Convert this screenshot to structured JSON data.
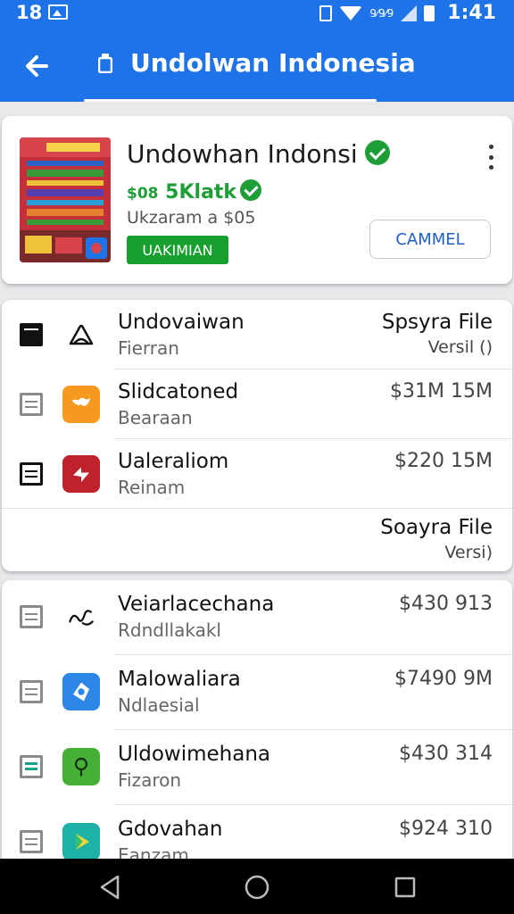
{
  "status_bar": {
    "left_text": "18",
    "signal_text": "9⁄9⁄9",
    "time": "1:41"
  },
  "app_bar": {
    "title": "Undolwan Indonesia",
    "icons": [
      "back-arrow-icon",
      "lock-icon"
    ]
  },
  "header": {
    "app_name": "Undowhan Indonsi",
    "price_prefix": "$08",
    "price_text": "5Klatk",
    "size_text": "Ukzaram a  $05",
    "badge": "UAKIMIAN",
    "cancel_label": "CAMMEL",
    "accent": "#1f73e8",
    "green": "#1e9e36"
  },
  "list1": {
    "rows": [
      {
        "name": "Undovaiwan",
        "sub": "Fierran",
        "amount": "Spsyra File",
        "amount2": "Versil ()",
        "icon": "recycle-outline-icon"
      },
      {
        "name": "Slidcatoned",
        "sub": "Bearaan",
        "amount": "$31M 15M",
        "amount2": "",
        "icon": "bird-icon"
      },
      {
        "name": "Ualeraliom",
        "sub": "Reinam",
        "amount": "$220  15M",
        "amount2": "",
        "icon": "arrow-right-icon"
      }
    ],
    "footer_title": "Soayra File",
    "footer_sub": "Versi)"
  },
  "list2": {
    "rows": [
      {
        "name": "Veiarlacechana",
        "sub": "Rdndllakakl",
        "amount": "$430 913",
        "icon": "script-glyph-icon"
      },
      {
        "name": "Malowaliara",
        "sub": "Ndlaesial",
        "amount": "$7490 9M",
        "icon": "shield-compass-icon"
      },
      {
        "name": "Uldowimehana",
        "sub": "Fizaron",
        "amount": "$430 314",
        "icon": "pin-icon"
      },
      {
        "name": "Gdovahan",
        "sub": "Eanzam",
        "amount": "$924 310",
        "icon": "play-icon"
      }
    ]
  },
  "nav": {
    "icons": [
      "back-triangle-icon",
      "home-circle-icon",
      "recents-square-icon"
    ]
  }
}
